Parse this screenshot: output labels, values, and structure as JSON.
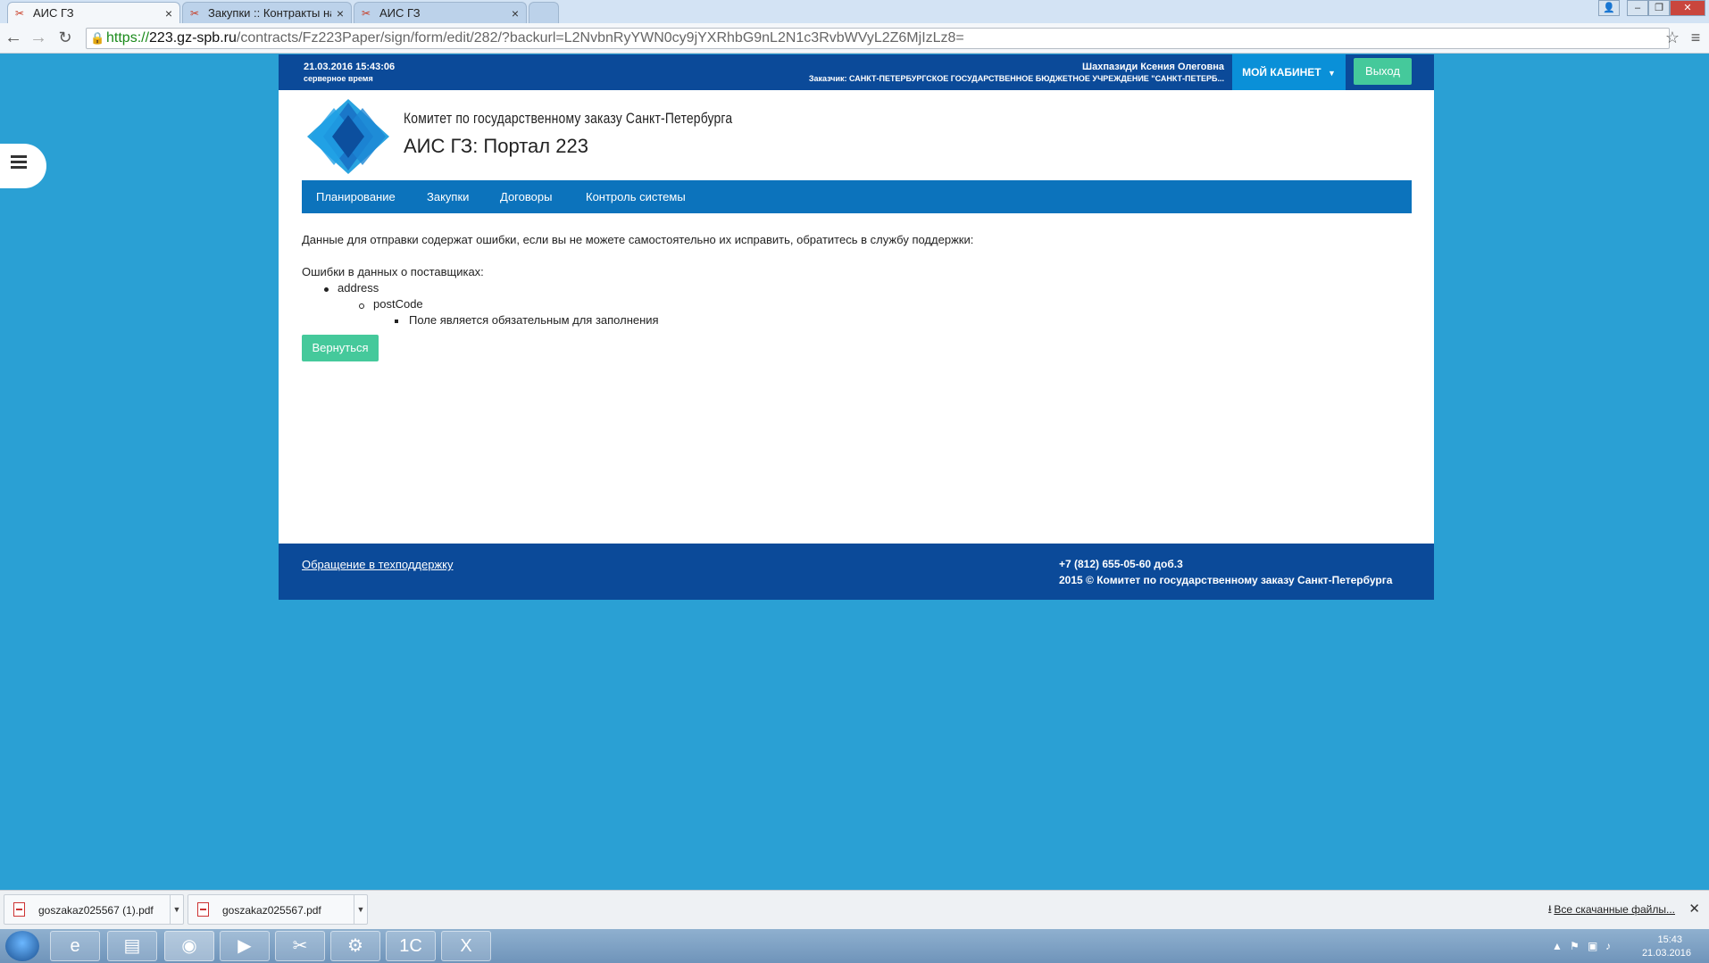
{
  "browser": {
    "tabs": [
      {
        "label": "АИС ГЗ",
        "active": true
      },
      {
        "label": "Закупки :: Контракты на",
        "active": false
      },
      {
        "label": "АИС ГЗ",
        "active": false
      }
    ],
    "url": {
      "scheme": "https://",
      "host": "223.gz-spb.ru",
      "path": "/contracts/Fz223Paper/sign/form/edit/282/?backurl=L2NvbnRyYWN0cy9jYXRhbG9nL2N1c3RvbWVyL2Z6MjIzLz8="
    }
  },
  "topbar": {
    "server_time": "21.03.2016 15:43:06",
    "server_time_label": "серверное время",
    "user_name": "Шахпазиди Ксения Олеговна",
    "customer": "Заказчик: САНКТ-ПЕТЕРБУРГСКОЕ ГОСУДАРСТВЕННОЕ БЮДЖЕТНОЕ УЧРЕЖДЕНИЕ \"САНКТ-ПЕТЕРБ...",
    "cabinet_label": "МОЙ КАБИНЕТ",
    "exit_label": "Выход"
  },
  "header": {
    "org_name": "Комитет по государственному заказу Санкт-Петербурга",
    "portal_title": "АИС ГЗ: Портал 223"
  },
  "nav": [
    "Планирование",
    "Закупки",
    "Договоры",
    "Контроль системы"
  ],
  "content": {
    "message": "Данные для отправки содержат ошибки, если вы не можете самостоятельно их исправить, обратитесь в службу поддержки:",
    "errors_heading": "Ошибки в данных о поставщиках:",
    "error_field": "address",
    "error_subfield": "postCode",
    "error_text": "Поле является обязательным для заполнения",
    "back_label": "Вернуться"
  },
  "footer": {
    "support_link": "Обращение в техподдержку",
    "phone": "+7 (812) 655-05-60 доб.3",
    "copyright": "2015 © Комитет по государственному заказу Санкт-Петербурга"
  },
  "downloads": {
    "items": [
      "goszakaz025567 (1).pdf",
      "goszakaz025567.pdf"
    ],
    "all_label": "Все скачанные файлы..."
  },
  "taskbar": {
    "time": "15:43",
    "date": "21.03.2016"
  }
}
